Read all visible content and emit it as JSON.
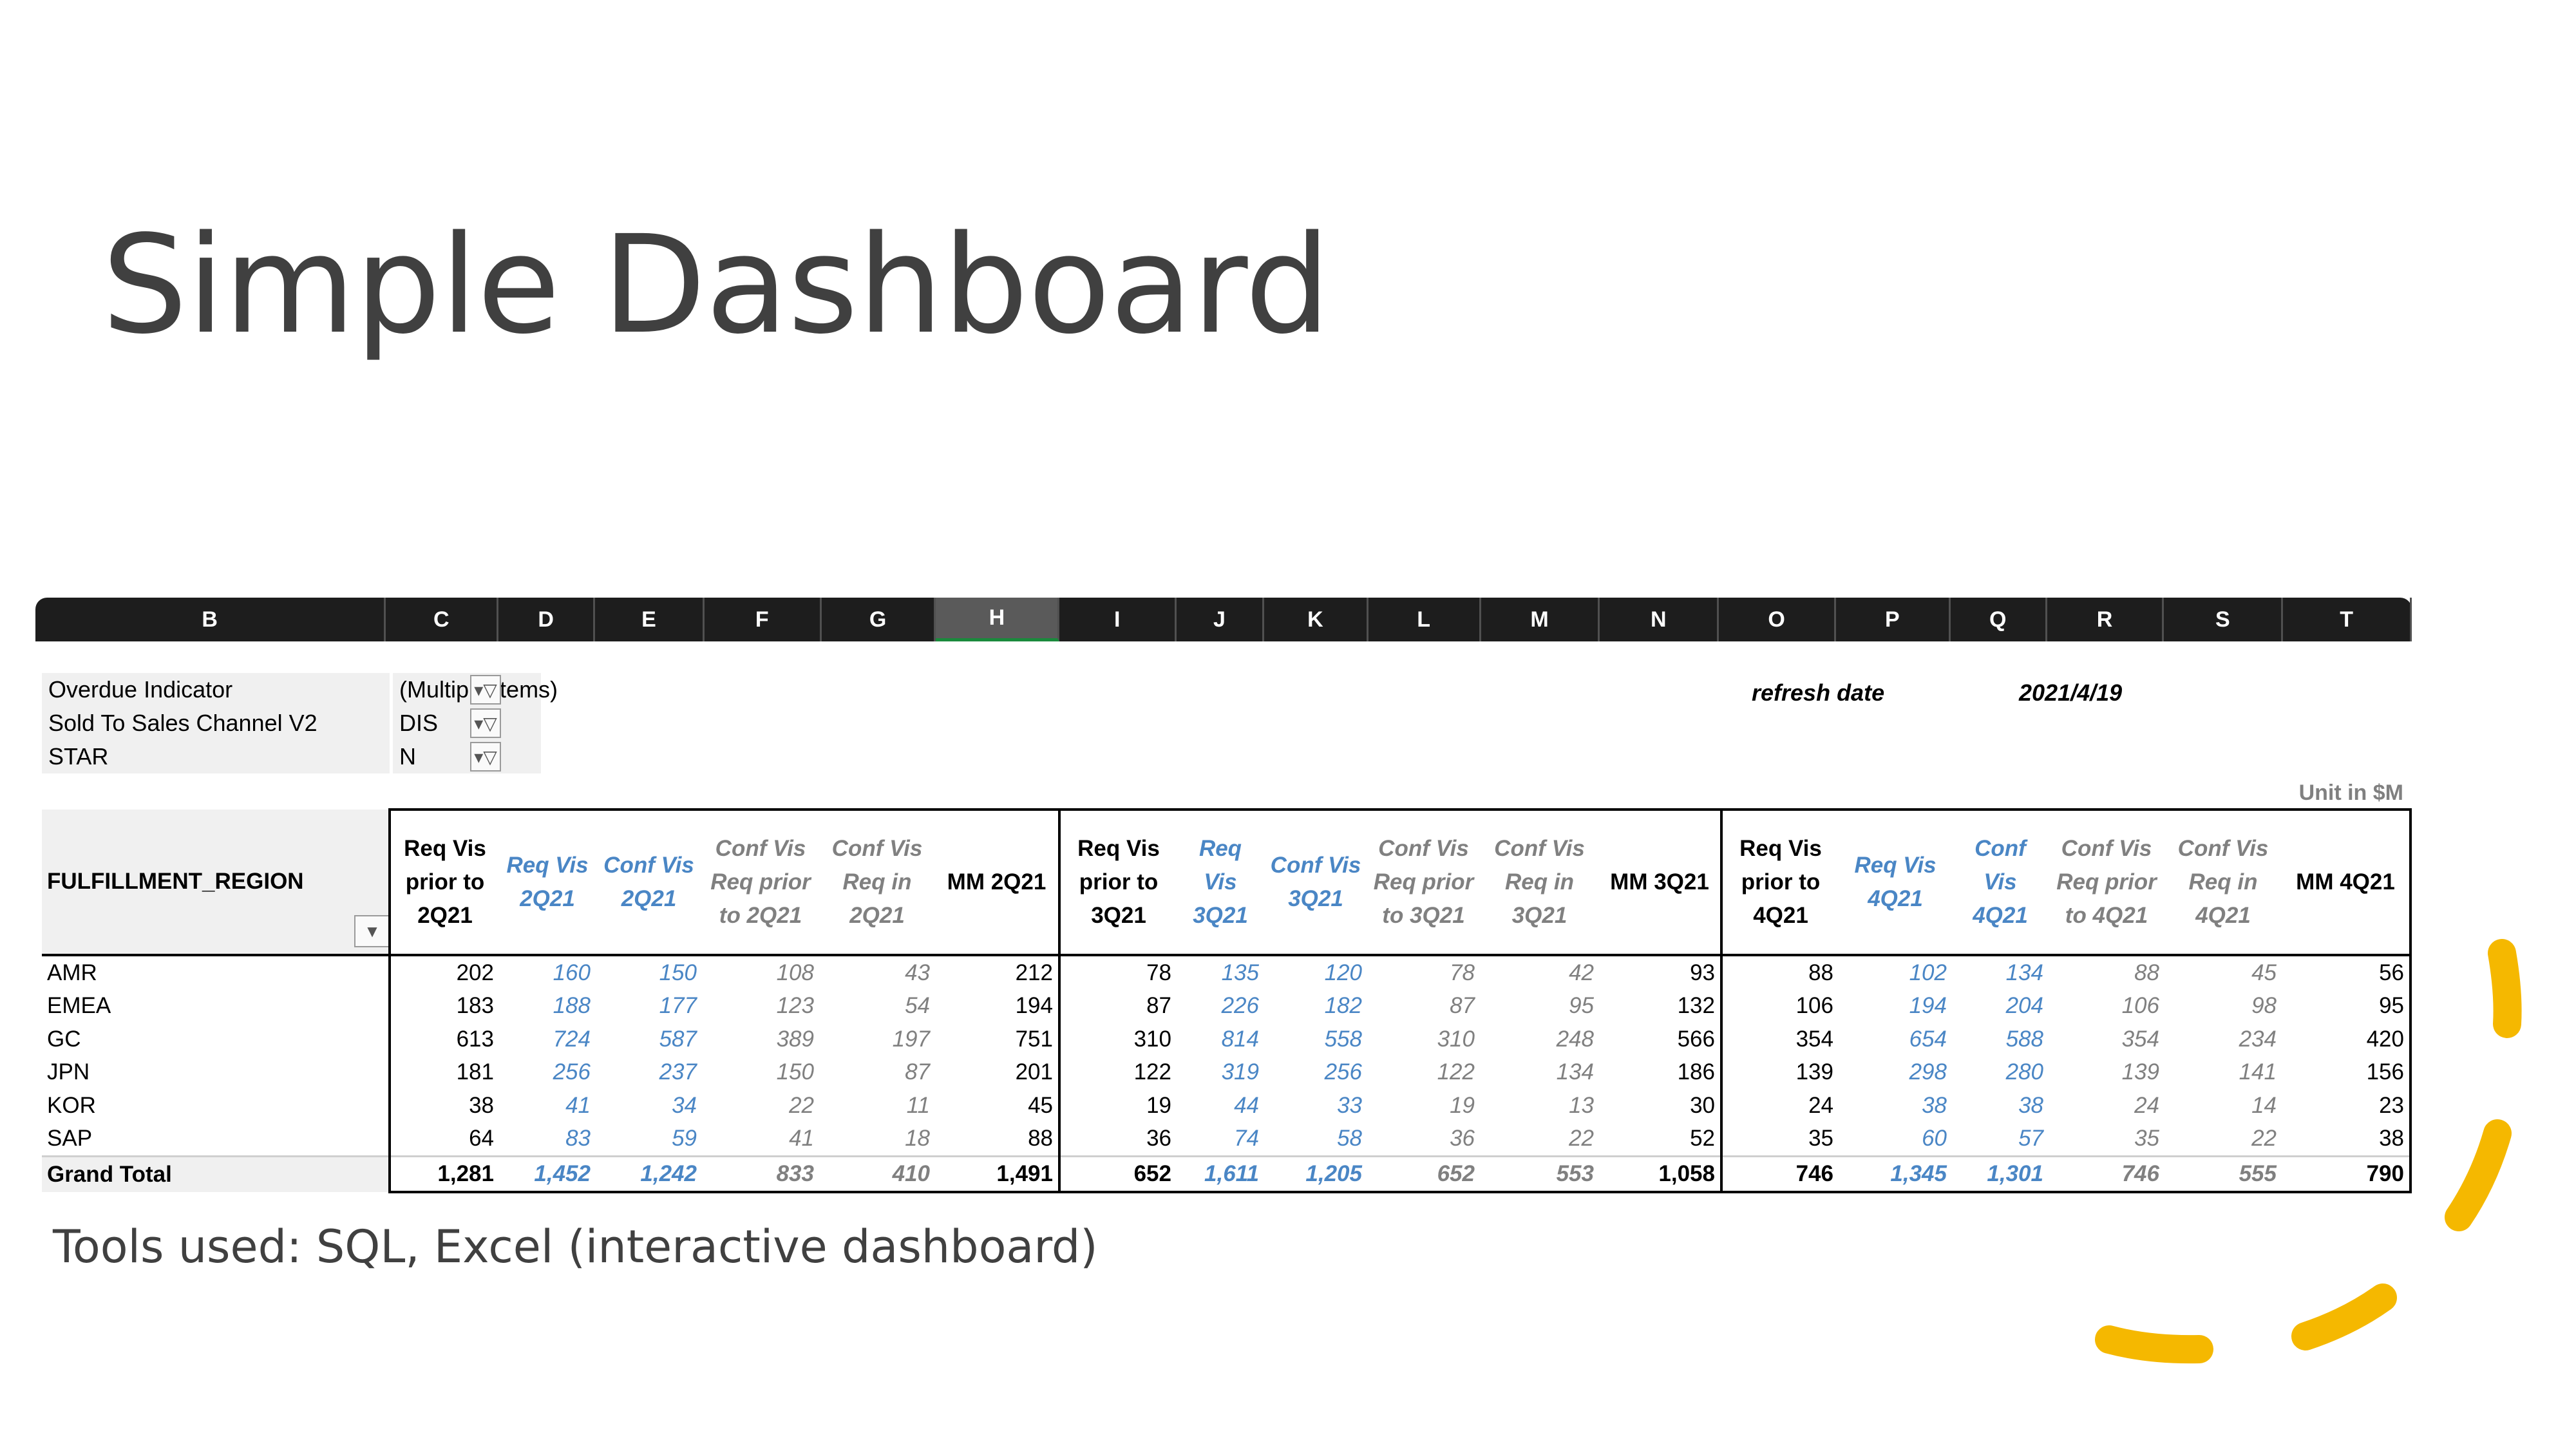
{
  "slide": {
    "title": "Simple Dashboard",
    "caption": "Tools used: SQL, Excel (interactive dashboard)"
  },
  "sheet": {
    "columns": [
      "B",
      "C",
      "D",
      "E",
      "F",
      "G",
      "H",
      "I",
      "J",
      "K",
      "L",
      "M",
      "N",
      "O",
      "P",
      "Q",
      "R",
      "S",
      "T"
    ],
    "selected_column": "H"
  },
  "filters": [
    {
      "label": "Overdue Indicator",
      "value": "(Multiple Items)"
    },
    {
      "label": "Sold To Sales Channel V2",
      "value": "DIS"
    },
    {
      "label": "STAR",
      "value": "N"
    }
  ],
  "refresh": {
    "label": "refresh date",
    "value": "2021/4/19"
  },
  "unit_note": "Unit in $M",
  "pivot": {
    "row_header": "FULFILLMENT_REGION",
    "headers": [
      "Req Vis prior to 2Q21",
      "Req Vis 2Q21",
      "Conf Vis 2Q21",
      "Conf Vis Req prior to 2Q21",
      "Conf Vis Req in 2Q21",
      "MM 2Q21",
      "Req Vis prior to 3Q21",
      "Req Vis 3Q21",
      "Conf Vis 3Q21",
      "Conf Vis Req prior to 3Q21",
      "Conf Vis Req in 3Q21",
      "MM 3Q21",
      "Req Vis prior to 4Q21",
      "Req Vis 4Q21",
      "Conf Vis 4Q21",
      "Conf Vis Req prior to 4Q21",
      "Conf Vis Req in 4Q21",
      "MM 4Q21"
    ],
    "rows": [
      {
        "region": "AMR",
        "values": [
          "202",
          "160",
          "150",
          "108",
          "43",
          "212",
          "78",
          "135",
          "120",
          "78",
          "42",
          "93",
          "88",
          "102",
          "134",
          "88",
          "45",
          "56"
        ]
      },
      {
        "region": "EMEA",
        "values": [
          "183",
          "188",
          "177",
          "123",
          "54",
          "194",
          "87",
          "226",
          "182",
          "87",
          "95",
          "132",
          "106",
          "194",
          "204",
          "106",
          "98",
          "95"
        ]
      },
      {
        "region": "GC",
        "values": [
          "613",
          "724",
          "587",
          "389",
          "197",
          "751",
          "310",
          "814",
          "558",
          "310",
          "248",
          "566",
          "354",
          "654",
          "588",
          "354",
          "234",
          "420"
        ]
      },
      {
        "region": "JPN",
        "values": [
          "181",
          "256",
          "237",
          "150",
          "87",
          "201",
          "122",
          "319",
          "256",
          "122",
          "134",
          "186",
          "139",
          "298",
          "280",
          "139",
          "141",
          "156"
        ]
      },
      {
        "region": "KOR",
        "values": [
          "38",
          "41",
          "34",
          "22",
          "11",
          "45",
          "19",
          "44",
          "33",
          "19",
          "13",
          "30",
          "24",
          "38",
          "38",
          "24",
          "14",
          "23"
        ]
      },
      {
        "region": "SAP",
        "values": [
          "64",
          "83",
          "59",
          "41",
          "18",
          "88",
          "36",
          "74",
          "58",
          "36",
          "22",
          "52",
          "35",
          "60",
          "57",
          "35",
          "22",
          "38"
        ]
      }
    ],
    "total": {
      "region": "Grand Total",
      "values": [
        "1,281",
        "1,452",
        "1,242",
        "833",
        "410",
        "1,491",
        "652",
        "1,611",
        "1,205",
        "652",
        "553",
        "1,058",
        "746",
        "1,345",
        "1,301",
        "746",
        "555",
        "790"
      ]
    }
  },
  "colors": {
    "accent_yellow": "#f5b800",
    "blue_values": "#4a86c5",
    "gray_values": "#808080",
    "header_bar": "#1d1d1d"
  }
}
